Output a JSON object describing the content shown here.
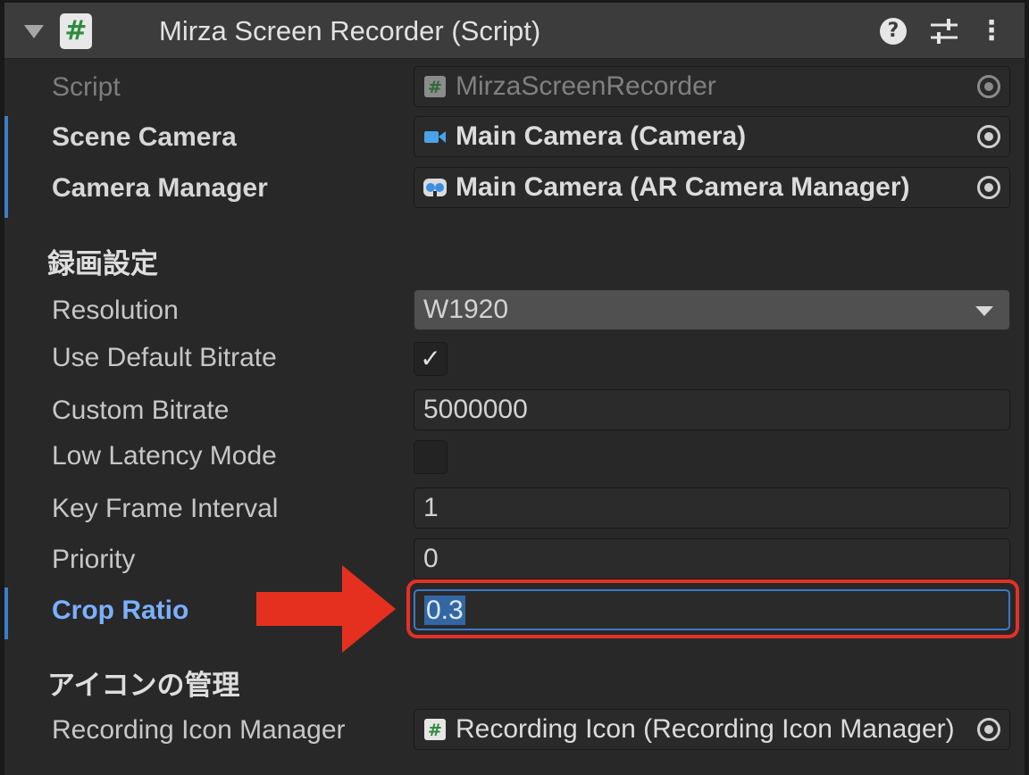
{
  "header": {
    "title": "Mirza Screen Recorder (Script)",
    "script_badge": "#",
    "help_icon": "?",
    "presets_icon": "presets-icon",
    "more_icon": "⋮"
  },
  "fields": {
    "script": {
      "label": "Script",
      "value": "MirzaScreenRecorder",
      "icon": "#"
    },
    "scene_camera": {
      "label": "Scene Camera",
      "value": "Main Camera (Camera)"
    },
    "camera_manager": {
      "label": "Camera Manager",
      "value": "Main Camera (AR Camera Manager)"
    },
    "section_recording": "録画設定",
    "resolution": {
      "label": "Resolution",
      "value": "W1920"
    },
    "use_default_bitrate": {
      "label": "Use Default Bitrate",
      "checked": true,
      "mark": "✓"
    },
    "custom_bitrate": {
      "label": "Custom Bitrate",
      "value": "5000000"
    },
    "low_latency_mode": {
      "label": "Low Latency Mode",
      "checked": false
    },
    "key_frame_interval": {
      "label": "Key Frame Interval",
      "value": "1"
    },
    "priority": {
      "label": "Priority",
      "value": "0"
    },
    "crop_ratio": {
      "label": "Crop Ratio",
      "value": "0.3"
    },
    "section_icons": "アイコンの管理",
    "recording_icon_manager": {
      "label": "Recording Icon Manager",
      "value": "Recording Icon (Recording Icon Manager)",
      "icon": "#"
    }
  },
  "colors": {
    "accent_blue": "#3d7ec7",
    "highlight_red": "#e33128",
    "panel_bg": "#282828"
  }
}
